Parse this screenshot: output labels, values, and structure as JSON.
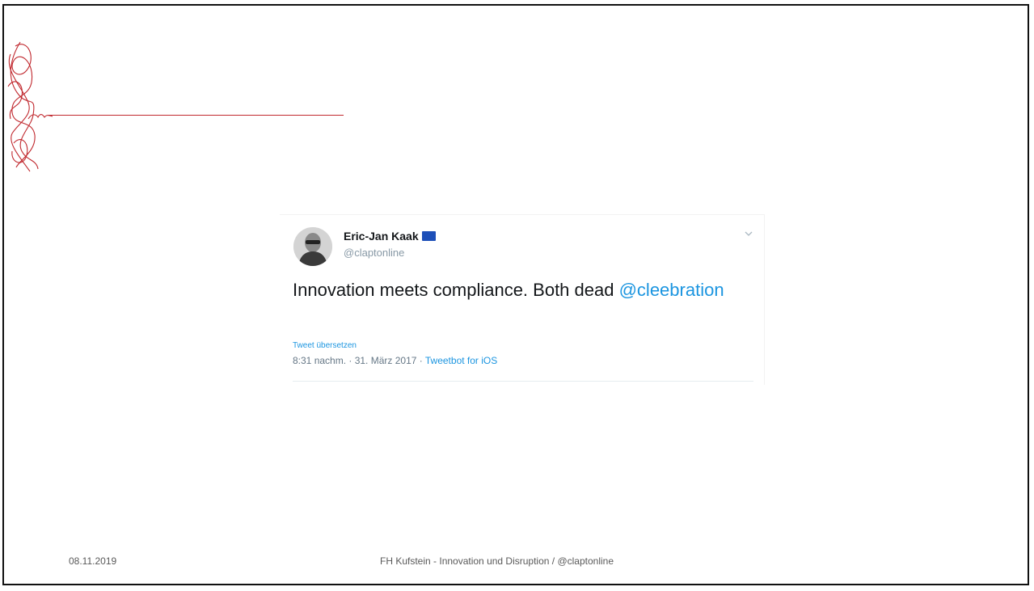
{
  "tweet": {
    "author_name": "Eric-Jan Kaak",
    "author_flag_icon": "eu-flag-icon",
    "handle": "@claptonline",
    "text_main": "Innovation meets compliance. Both dead ",
    "text_mention": "@cleebration",
    "translate_link": "Tweet übersetzen",
    "timestamp": "8:31 nachm. · 31. März 2017 · ",
    "client": "Tweetbot for iOS",
    "menu_icon": "chevron-down-icon"
  },
  "footer": {
    "date": "08.11.2019",
    "text": "FH Kufstein - Innovation und Disruption / @claptonline"
  },
  "colors": {
    "accent_red": "#c0272d",
    "link_blue": "#1b95e0",
    "text_dark": "#14171a",
    "text_muted": "#657786"
  }
}
